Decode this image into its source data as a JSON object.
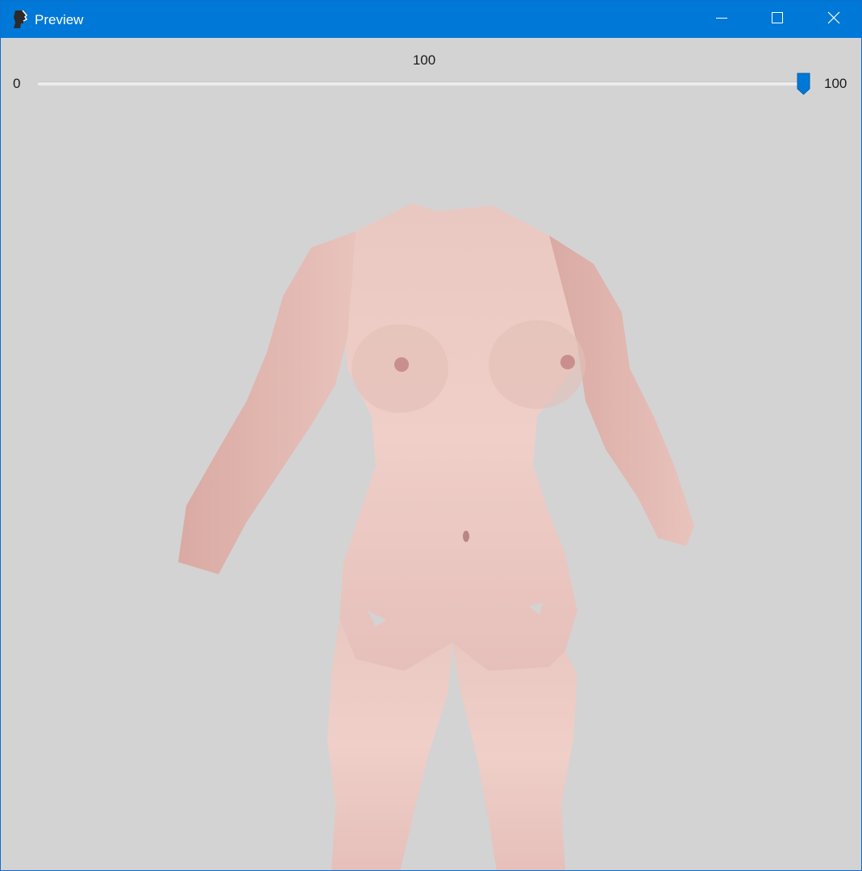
{
  "window": {
    "title": "Preview",
    "app_icon": "head-silhouette-icon",
    "controls": {
      "minimize_icon": "minimize-icon",
      "maximize_icon": "maximize-icon",
      "close_icon": "close-icon"
    },
    "titlebar_color": "#0078d7"
  },
  "slider": {
    "value_label": "100",
    "value": 100,
    "min_label": "0",
    "max_label": "100",
    "accent_color": "#0078d7"
  },
  "viewport": {
    "background_color": "#d3d3d3",
    "content": "3d-body-mesh-preview"
  }
}
